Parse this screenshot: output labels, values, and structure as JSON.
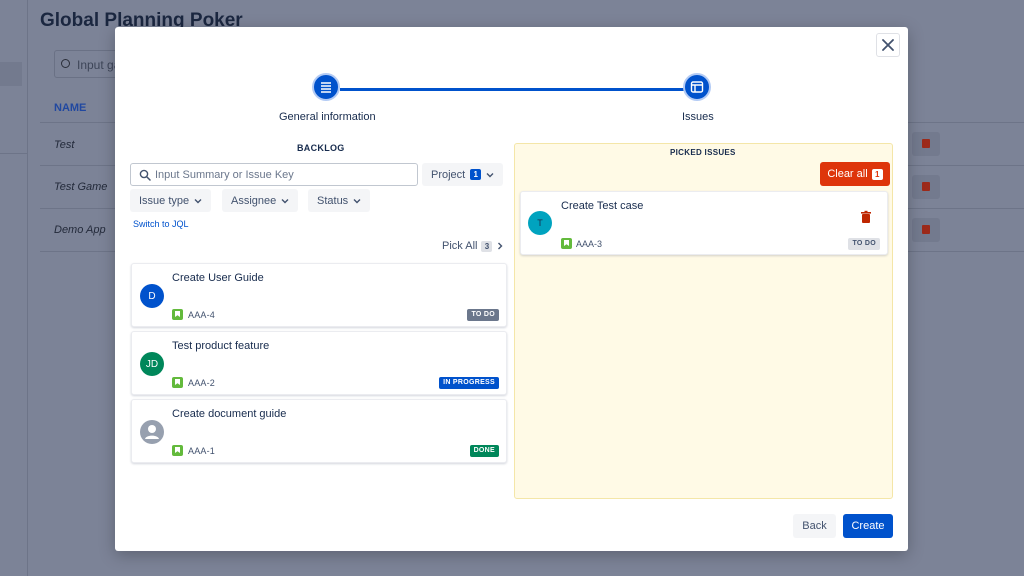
{
  "background": {
    "title": "Global Planning Poker",
    "search_placeholder": "Input ga",
    "column_name": "NAME",
    "rows": [
      "Test",
      "Test Game",
      "Demo App"
    ]
  },
  "stepper": {
    "steps": [
      {
        "label": "General information",
        "icon": "list-icon"
      },
      {
        "label": "Issues",
        "icon": "board-icon"
      }
    ]
  },
  "backlog": {
    "title": "BACKLOG",
    "search_placeholder": "Input Summary or Issue Key",
    "project_label": "Project",
    "project_count": "1",
    "filters": [
      "Issue type",
      "Assignee",
      "Status"
    ],
    "switch_jql": "Switch to JQL",
    "pick_all_label": "Pick All",
    "pick_all_count": "3",
    "issues": [
      {
        "summary": "Create User Guide",
        "key": "AAA-4",
        "status": "TO DO",
        "avatar": "D",
        "avatar_color": "#0052cc"
      },
      {
        "summary": "Test product feature",
        "key": "AAA-2",
        "status": "IN PROGRESS",
        "avatar": "JD",
        "avatar_color": "#00875a"
      },
      {
        "summary": "Create document guide",
        "key": "AAA-1",
        "status": "DONE",
        "avatar": "",
        "avatar_color": "#97a0af"
      }
    ]
  },
  "picked": {
    "title": "PICKED ISSUES",
    "clear_all_label": "Clear all",
    "clear_all_count": "1",
    "issues": [
      {
        "summary": "Create Test case",
        "key": "AAA-3",
        "status": "TO DO",
        "avatar": "T",
        "avatar_color": "#00a3bf"
      }
    ]
  },
  "footer": {
    "back_label": "Back",
    "create_label": "Create"
  },
  "colors": {
    "primary": "#0052cc",
    "danger": "#de350b",
    "success": "#00875a",
    "story": "#63ba3c",
    "picked_bg": "#fffae6"
  }
}
